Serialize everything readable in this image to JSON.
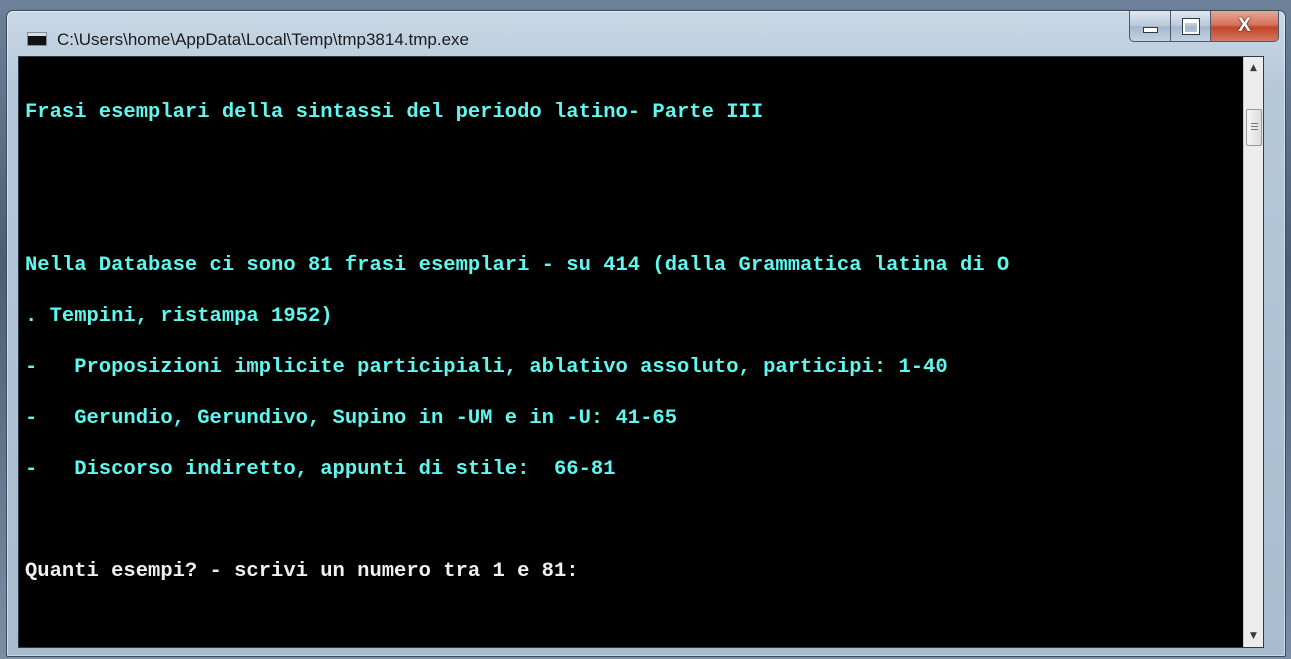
{
  "window": {
    "title": "C:\\Users\\home\\AppData\\Local\\Temp\\tmp3814.tmp.exe",
    "close_label": "X"
  },
  "console": {
    "lines": [
      {
        "text": "Frasi esemplari della sintassi del periodo latino- Parte III",
        "color": "cyan"
      },
      {
        "text": "",
        "color": "cyan"
      },
      {
        "text": "",
        "color": "cyan"
      },
      {
        "text": "Nella Database ci sono 81 frasi esemplari - su 414 (dalla Grammatica latina di O",
        "color": "cyan"
      },
      {
        "text": ". Tempini, ristampa 1952)",
        "color": "cyan"
      },
      {
        "text": "-   Proposizioni implicite participiali, ablativo assoluto, participi: 1-40",
        "color": "cyan"
      },
      {
        "text": "-   Gerundio, Gerundivo, Supino in -UM e in -U: 41-65",
        "color": "cyan"
      },
      {
        "text": "-   Discorso indiretto, appunti di stile:  66-81",
        "color": "cyan"
      },
      {
        "text": "",
        "color": "cyan"
      },
      {
        "text": "Quanti esempi? - scrivi un numero tra 1 e 81:",
        "color": "white"
      }
    ]
  },
  "colors": {
    "console_bg": "#000000",
    "cyan_text": "#5ff7ee",
    "white_text": "#f0f0f0",
    "close_button": "#c4442a"
  },
  "icons": {
    "app": "console-app-icon",
    "minimize": "minimize-icon",
    "maximize": "maximize-icon",
    "close": "close-icon",
    "scroll_up": "scroll-up-arrow-icon",
    "scroll_down": "scroll-down-arrow-icon"
  }
}
